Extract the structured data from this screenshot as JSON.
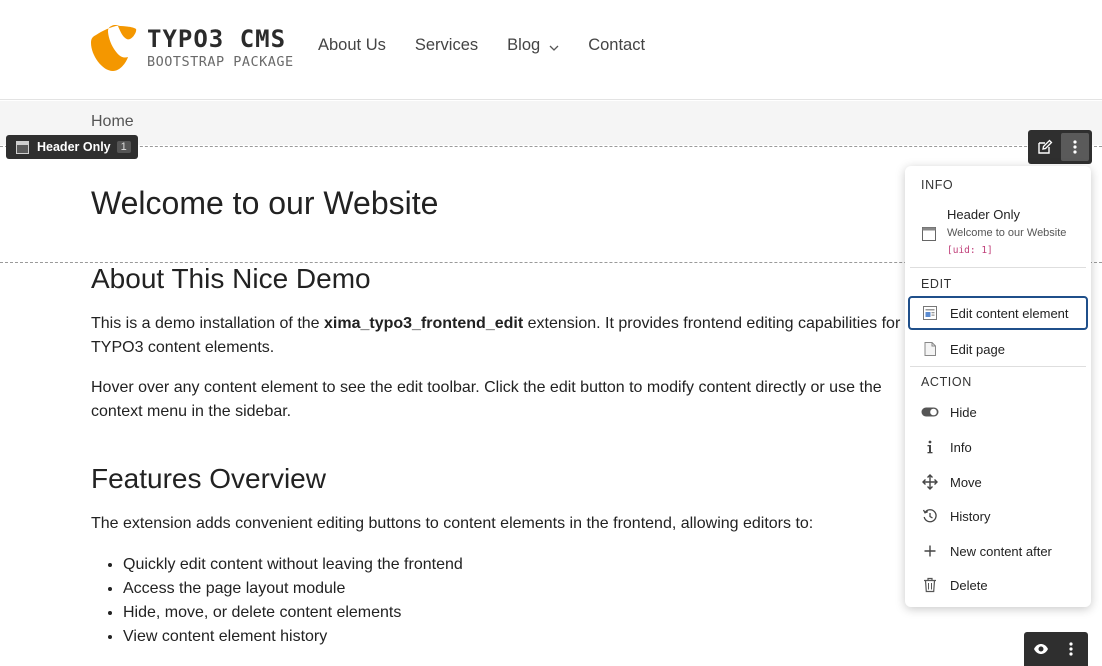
{
  "header": {
    "logo": {
      "title": "TYPO3 CMS",
      "subtitle": "BOOTSTRAP PACKAGE",
      "color": "#f49700"
    },
    "nav": [
      {
        "label": "About Us"
      },
      {
        "label": "Services"
      },
      {
        "label": "Blog",
        "has_dropdown": true
      },
      {
        "label": "Contact"
      }
    ]
  },
  "breadcrumb": {
    "current": "Home"
  },
  "content_element_label": {
    "type": "Header Only",
    "uid": "1"
  },
  "content": {
    "h1": "Welcome to our Website",
    "section1": {
      "heading": "About This Nice Demo",
      "p1_before": "This is a demo installation of the ",
      "p1_bold": "xima_typo3_frontend_edit",
      "p1_after": " extension. It provides frontend editing capabilities for TYPO3 content elements.",
      "p2": "Hover over any content element to see the edit toolbar. Click the edit button to modify content directly or use the context menu in the sidebar."
    },
    "section2": {
      "heading": "Features Overview",
      "intro": "The extension adds convenient editing buttons to content elements in the frontend, allowing editors to:",
      "items": [
        "Quickly edit content without leaving the frontend",
        "Access the page layout module",
        "Hide, move, or delete content elements",
        "View content element history"
      ]
    }
  },
  "context_menu": {
    "info_heading": "INFO",
    "info_title": "Header Only",
    "info_subtitle": "Welcome to our Website",
    "info_uid": "[uid: 1]",
    "edit_heading": "EDIT",
    "edit_items": [
      {
        "label": "Edit content element",
        "icon": "content-element-icon"
      },
      {
        "label": "Edit page",
        "icon": "page-icon"
      }
    ],
    "action_heading": "ACTION",
    "action_items": [
      {
        "label": "Hide",
        "icon": "toggle-icon"
      },
      {
        "label": "Info",
        "icon": "info-icon"
      },
      {
        "label": "Move",
        "icon": "move-icon"
      },
      {
        "label": "History",
        "icon": "history-icon"
      },
      {
        "label": "New content after",
        "icon": "plus-icon"
      },
      {
        "label": "Delete",
        "icon": "trash-icon"
      }
    ]
  }
}
